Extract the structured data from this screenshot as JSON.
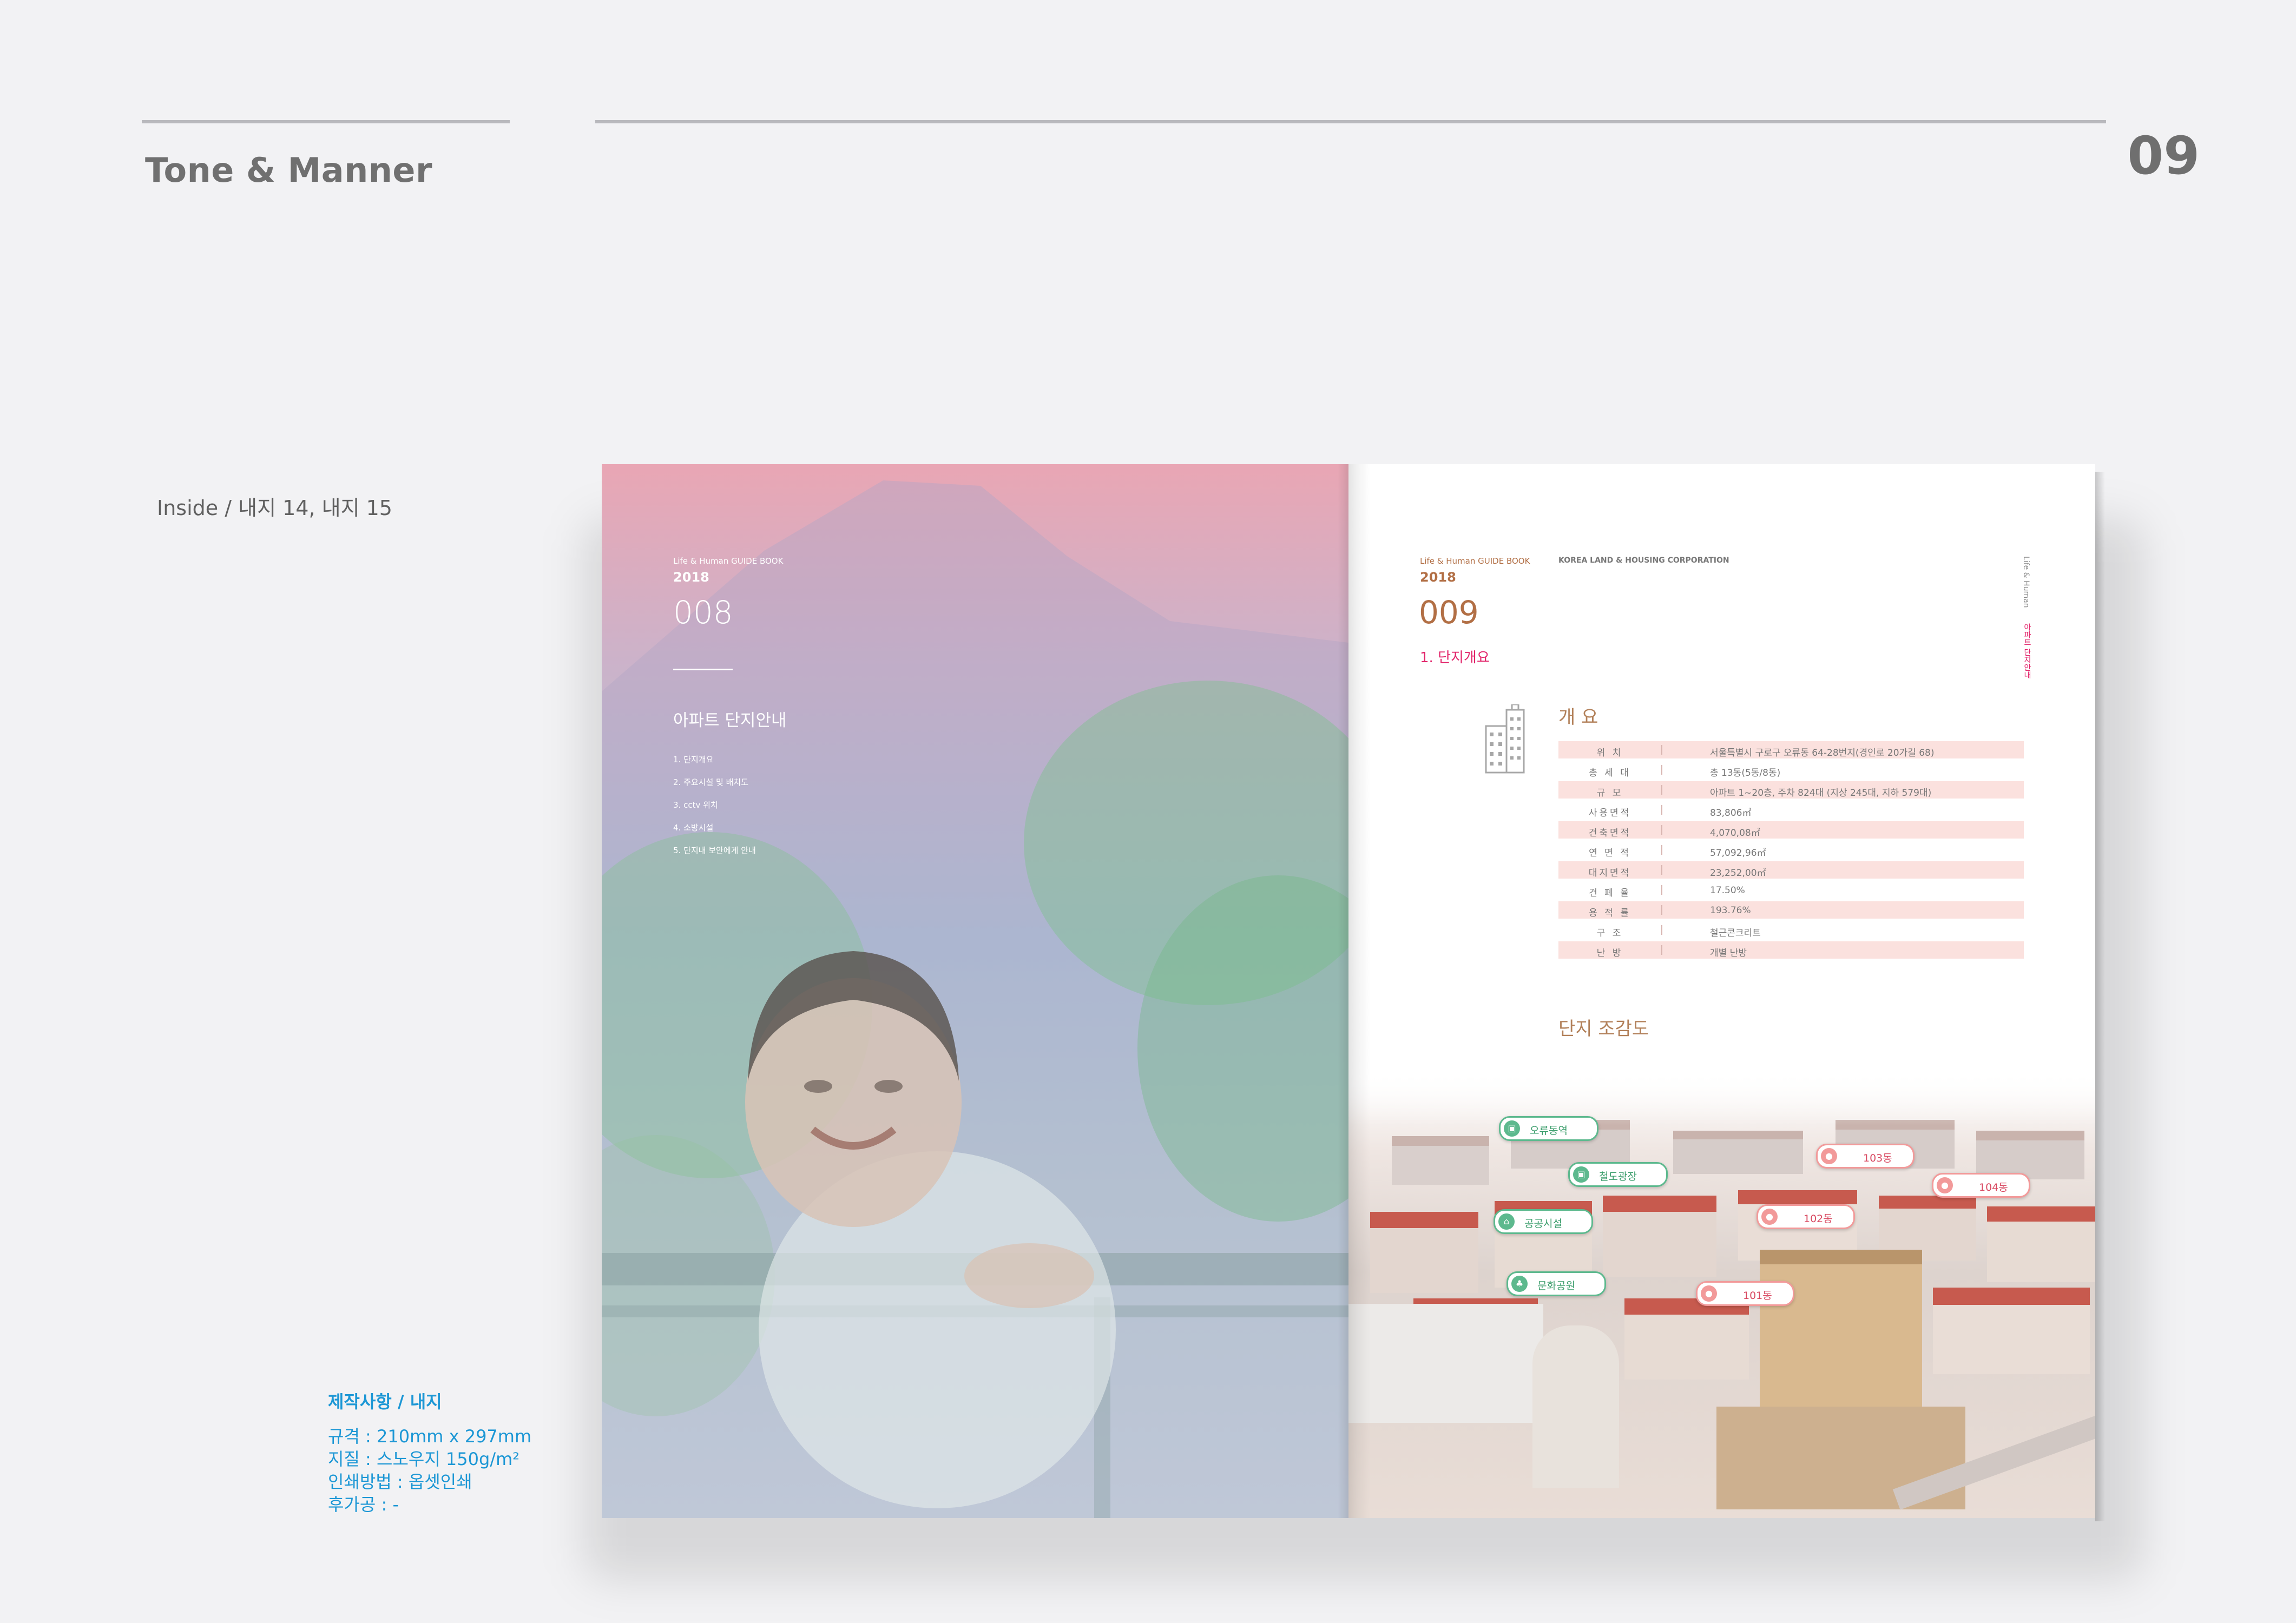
{
  "header": {
    "section_title": "Tone & Manner",
    "page_number": "09"
  },
  "inside_label": "Inside / 내지 14, 내지 15",
  "specs": {
    "title": "제작사항 / 내지",
    "lines": [
      "규격 : 210mm x 297mm",
      "지질 : 스노우지 150g/m²",
      "인쇄방법 : 옵셋인쇄",
      "후가공 : -"
    ]
  },
  "left_page": {
    "series": "Life & Human GUIDE BOOK",
    "year": "2018",
    "number": "008",
    "title": "아파트 단지안내",
    "toc": [
      "1. 단지개요",
      "2. 주요시설 및 배치도",
      "3. cctv 위치",
      "4. 소방시설",
      "5. 단지내 보안에게 안내"
    ]
  },
  "right_page": {
    "series": "Life & Human GUIDE BOOK",
    "corporation": "KOREA LAND & HOUSING CORPORATION",
    "year": "2018",
    "number": "009",
    "subtitle": "1. 단지개요",
    "side_text": "Life & Human",
    "side_accent": "아파트 단지안내",
    "overview_heading": "개 요",
    "overview_rows": [
      {
        "label": "위 치",
        "value": "서울특별시 구로구 오류동 64-28번지(경인로 20가길 68)"
      },
      {
        "label": "총 세 대",
        "value": "총 13동(5동/8동)"
      },
      {
        "label": "규 모",
        "value": "아파트 1~20층, 주차 824대 (지상 245대, 지하 579대)"
      },
      {
        "label": "사용면적",
        "value": "83,806㎡"
      },
      {
        "label": "건축면적",
        "value": "4,070,08㎡"
      },
      {
        "label": "연 면 적",
        "value": "57,092,96㎡"
      },
      {
        "label": "대지면적",
        "value": "23,252,00㎡"
      },
      {
        "label": "건 폐 율",
        "value": "17.50%"
      },
      {
        "label": "용 적 률",
        "value": "193.76%"
      },
      {
        "label": "구 조",
        "value": "철근콘크리트"
      },
      {
        "label": "난 방",
        "value": "개별 난방"
      }
    ],
    "aerial_heading": "단지 조감도",
    "map_tags": {
      "station": "오류동역",
      "plaza": "철도광장",
      "public": "공공시설",
      "park": "문화공원",
      "b101": "101동",
      "b102": "102동",
      "b103": "103동",
      "b104": "104동"
    }
  },
  "colors": {
    "accent_pink": "#e2246a",
    "spec_blue": "#1c97d5",
    "tag_green": "#5db98e",
    "tag_red": "#f29a9a"
  }
}
